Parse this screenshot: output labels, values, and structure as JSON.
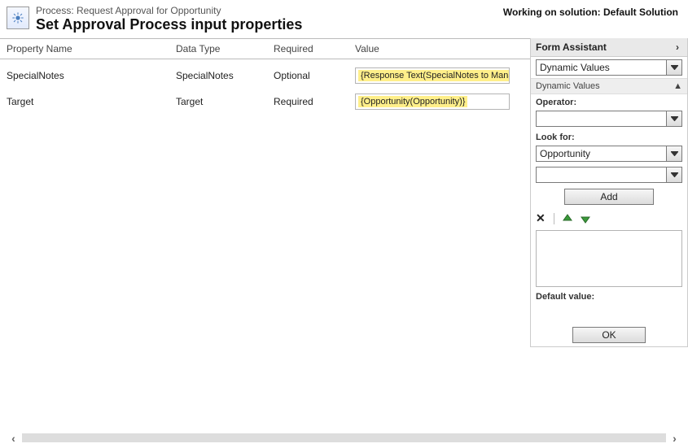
{
  "header": {
    "process_label": "Process: Request Approval for Opportunity",
    "title": "Set Approval Process input properties",
    "working_on": "Working on solution: Default Solution"
  },
  "columns": {
    "property_name": "Property Name",
    "data_type": "Data Type",
    "required": "Required",
    "value": "Value"
  },
  "rows": [
    {
      "property": "SpecialNotes",
      "data_type": "SpecialNotes",
      "required": "Optional",
      "value_token": "{Response Text(SpecialNotes to Manager)}"
    },
    {
      "property": "Target",
      "data_type": "Target",
      "required": "Required",
      "value_token": "{Opportunity(Opportunity)}"
    }
  ],
  "assistant": {
    "title": "Form Assistant",
    "top_select": "Dynamic Values",
    "section": "Dynamic Values",
    "operator_label": "Operator:",
    "operator_value": "",
    "look_for_label": "Look for:",
    "look_for_value": "Opportunity",
    "look_for_sub_value": "",
    "add_label": "Add",
    "default_label": "Default value:",
    "ok_label": "OK"
  }
}
